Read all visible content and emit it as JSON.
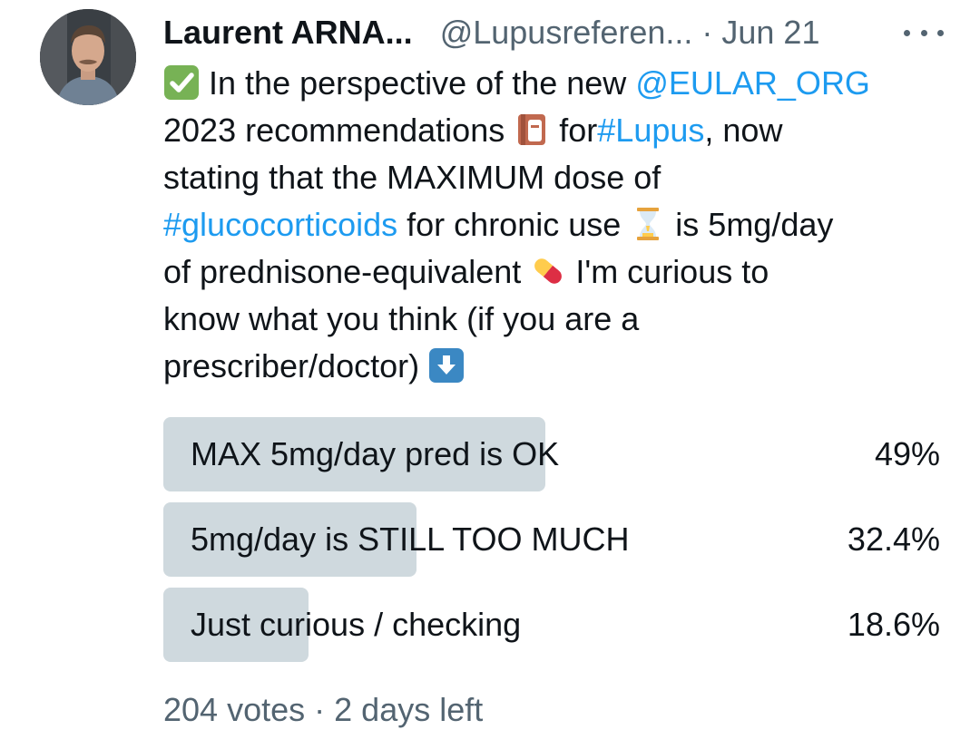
{
  "author": {
    "display_name": "Laurent ARNA...",
    "handle": "@Lupusreferen...",
    "separator": "·",
    "date": "Jun 21"
  },
  "icons": {
    "more": "more-horizontal-icon",
    "check": "check-mark-button-emoji",
    "book": "notebook-emoji",
    "hourglass": "hourglass-emoji",
    "pill": "pill-emoji",
    "down_arrow": "down-arrow-button-emoji"
  },
  "tweet": {
    "l1_text": "In the perspective of the new",
    "l1_mention": "@EULAR_ORG",
    "l2_text_a": "2023 recommendations",
    "l2_text_b": "for",
    "l2_hashtag": "#Lupus",
    "l2_text_c": ", now",
    "l3_text": "stating that the MAXIMUM dose of",
    "l4_hashtag": "#glucocorticoids",
    "l4_text_a": "for chronic use",
    "l4_text_b": "is 5mg/day",
    "l5_text_a": "of prednisone-equivalent",
    "l5_text_b": "I'm curious to",
    "l6_text": "know what you think (if you are a",
    "l7_text": "prescriber/doctor)"
  },
  "poll": {
    "options": [
      {
        "label": "MAX 5mg/day pred is OK",
        "percent": "49%",
        "share": 0.49
      },
      {
        "label": "5mg/day is STILL TOO MUCH",
        "percent": "32.4%",
        "share": 0.324
      },
      {
        "label": "Just curious / checking",
        "percent": "18.6%",
        "share": 0.186
      }
    ],
    "votes": "204 votes",
    "separator": "·",
    "time_left": "2 days left"
  },
  "colors": {
    "link": "#1d9bf0",
    "text": "#0f1419",
    "muted": "#536471",
    "poll_bar": "#cfd9de"
  }
}
